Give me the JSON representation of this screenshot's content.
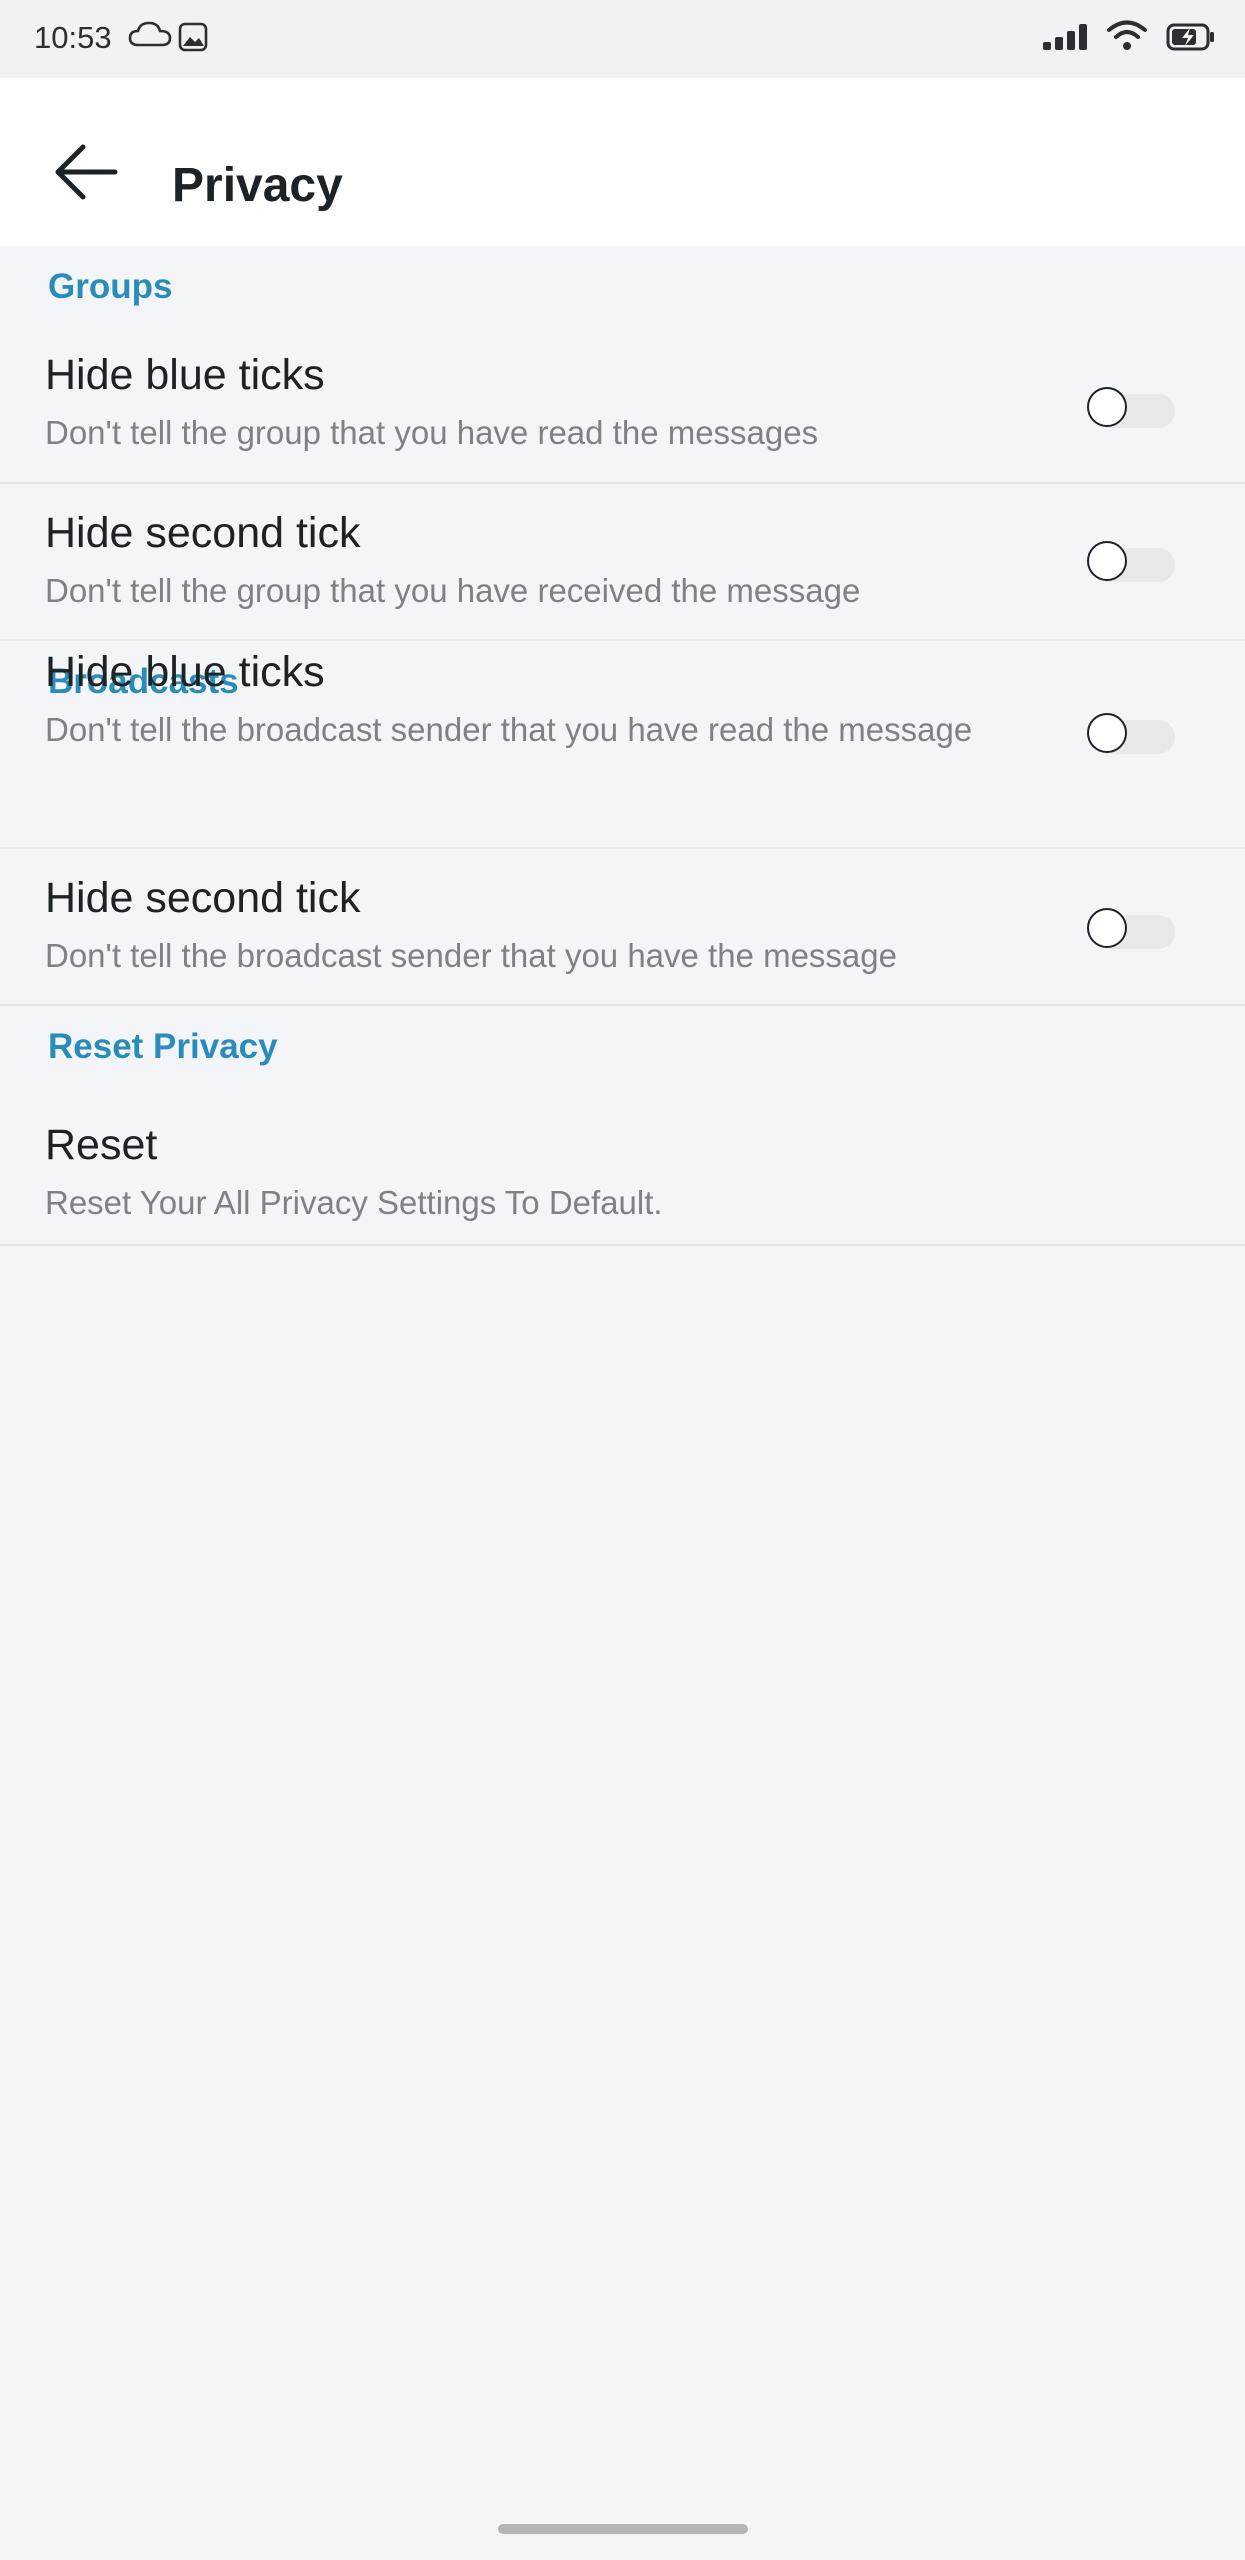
{
  "status_bar": {
    "time": "10:53",
    "icons": [
      "cloud-icon",
      "gallery-icon",
      "signal-icon",
      "wifi-icon",
      "battery-charging-icon"
    ]
  },
  "header": {
    "back_icon": "arrow-left-icon",
    "title": "Privacy"
  },
  "sections": {
    "groups": {
      "label": "Groups",
      "rows": [
        {
          "title": "Hide blue ticks",
          "description": "Don't tell the group that you have read the messages",
          "enabled": false
        },
        {
          "title": "Hide second tick",
          "description": "Don't tell the group that you have received the message",
          "enabled": false
        }
      ]
    },
    "broadcasts": {
      "label": "Broadcasts",
      "rows": [
        {
          "title": "Hide blue ticks",
          "description": "Don't tell the broadcast sender that you have read the message",
          "enabled": false
        },
        {
          "title": "Hide second tick",
          "description": "Don't tell the broadcast sender that you have the message",
          "enabled": false
        }
      ]
    },
    "reset_privacy": {
      "label": "Reset Privacy",
      "rows": [
        {
          "title": "Reset",
          "description": "Reset Your All Privacy Settings To Default."
        }
      ]
    }
  },
  "colors": {
    "accent": "#2a8cb8",
    "background": "#f4f5f9",
    "header_background": "#ffffff",
    "title_text": "#1d2227",
    "description_text": "#7c8288"
  }
}
